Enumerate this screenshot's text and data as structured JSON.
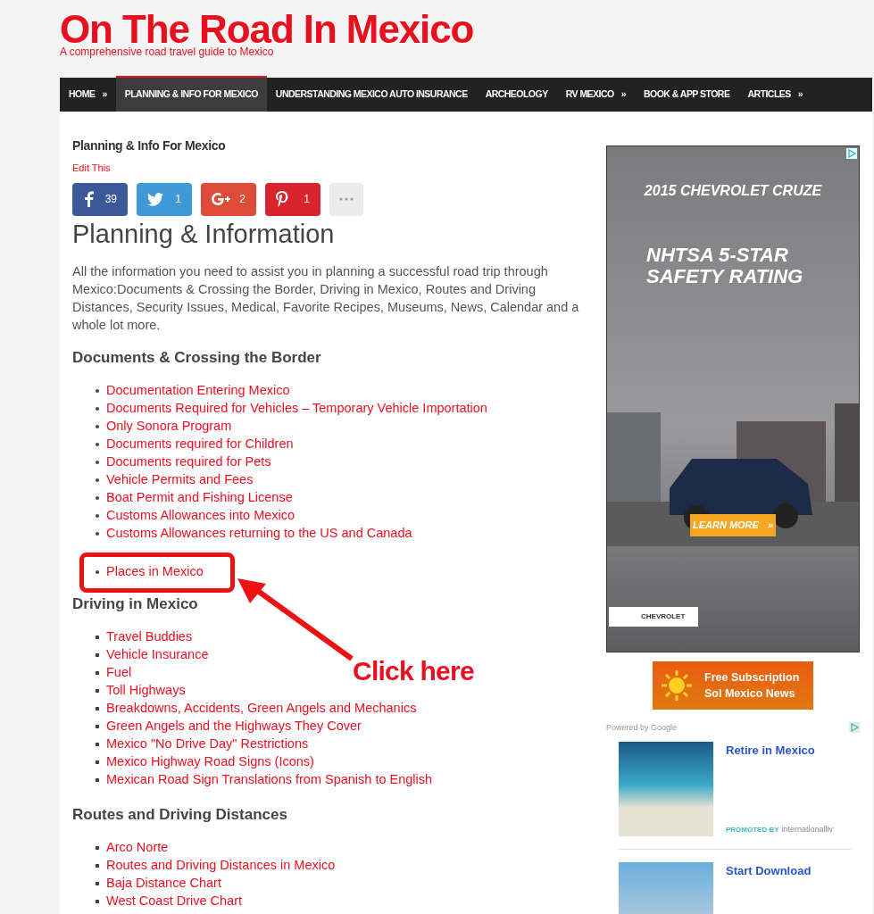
{
  "site": {
    "title": "On The Road In Mexico",
    "tagline": "A comprehensive road travel guide to Mexico"
  },
  "nav": [
    {
      "label": "HOME",
      "arrow": "»",
      "selected": false
    },
    {
      "label": "PLANNING & INFO FOR MEXICO",
      "selected": true
    },
    {
      "label": "UNDERSTANDING MEXICO AUTO INSURANCE",
      "selected": false
    },
    {
      "label": "ARCHEOLOGY",
      "selected": false
    },
    {
      "label": "RV MEXICO",
      "arrow": "»",
      "selected": false
    },
    {
      "label": "BOOK & APP STORE",
      "selected": false
    },
    {
      "label": "ARTICLES",
      "arrow": "»",
      "selected": false
    }
  ],
  "breadcrumb": "Planning & Info For Mexico",
  "edit_link": "Edit This",
  "share": [
    {
      "kind": "facebook",
      "count": "39"
    },
    {
      "kind": "twitter",
      "count": "1"
    },
    {
      "kind": "googleplus",
      "count": "2"
    },
    {
      "kind": "pinterest",
      "count": "1"
    },
    {
      "kind": "more"
    }
  ],
  "heading": "Planning & Information",
  "intro": "All the information you need to assist you in planning a successful road trip through Mexico:Documents & Crossing the Border, Driving in Mexico, Routes and Driving Distances, Security Issues, Medical, Favorite Recipes, Museums, News, Calendar and a whole lot more.",
  "sections": [
    {
      "title": "Documents & Crossing the Border",
      "kind": "dotted",
      "links": [
        "Documentation Entering Mexico",
        "Documents Required for Vehicles – Temporary Vehicle Importation",
        "Only Sonora Program",
        "Documents required for Children",
        "Documents required for Pets",
        "Vehicle Permits and Fees",
        "Boat Permit and Fishing License",
        "Customs Allowances into Mexico",
        "Customs Allowances returning to the US and Canada",
        "Places in Mexico"
      ]
    },
    {
      "title": "Driving in Mexico",
      "kind": "squared",
      "links": [
        "Travel Buddies",
        "Vehicle Insurance",
        "Fuel",
        "Toll Highways",
        "Breakdowns, Accidents, Green Angels and Mechanics",
        "Green Angels and the Highways They Cover",
        "Mexico \"No Drive Day\" Restrictions",
        "Mexico Highway Road Signs (Icons)",
        "Mexican Road Sign Translations from Spanish to English"
      ]
    },
    {
      "title": "Routes and Driving Distances",
      "kind": "squared",
      "links": [
        "Arco Norte",
        "Routes and Driving Distances in Mexico",
        "Baja Distance Chart",
        "West Coast Drive Chart"
      ]
    }
  ],
  "annotation": {
    "label": "Click here"
  },
  "ad": {
    "model": "2015 CHEVROLET CRUZE",
    "claim_line_1": "NHTSA 5-STAR",
    "claim_line_2": "SAFETY RATING",
    "button": "LEARN MORE",
    "arrows": "»",
    "brand": "CHEVROLET"
  },
  "promo_banner": {
    "line_1": "Free Subscription",
    "line_2": "Sol Mexico News"
  },
  "sponsored": {
    "powered_by": "Powered by Google",
    "items": [
      {
        "title": "Retire in Mexico",
        "promoted_label": "PROMOTED BY",
        "source": "internationalliv"
      },
      {
        "title": "Start Download"
      }
    ]
  }
}
